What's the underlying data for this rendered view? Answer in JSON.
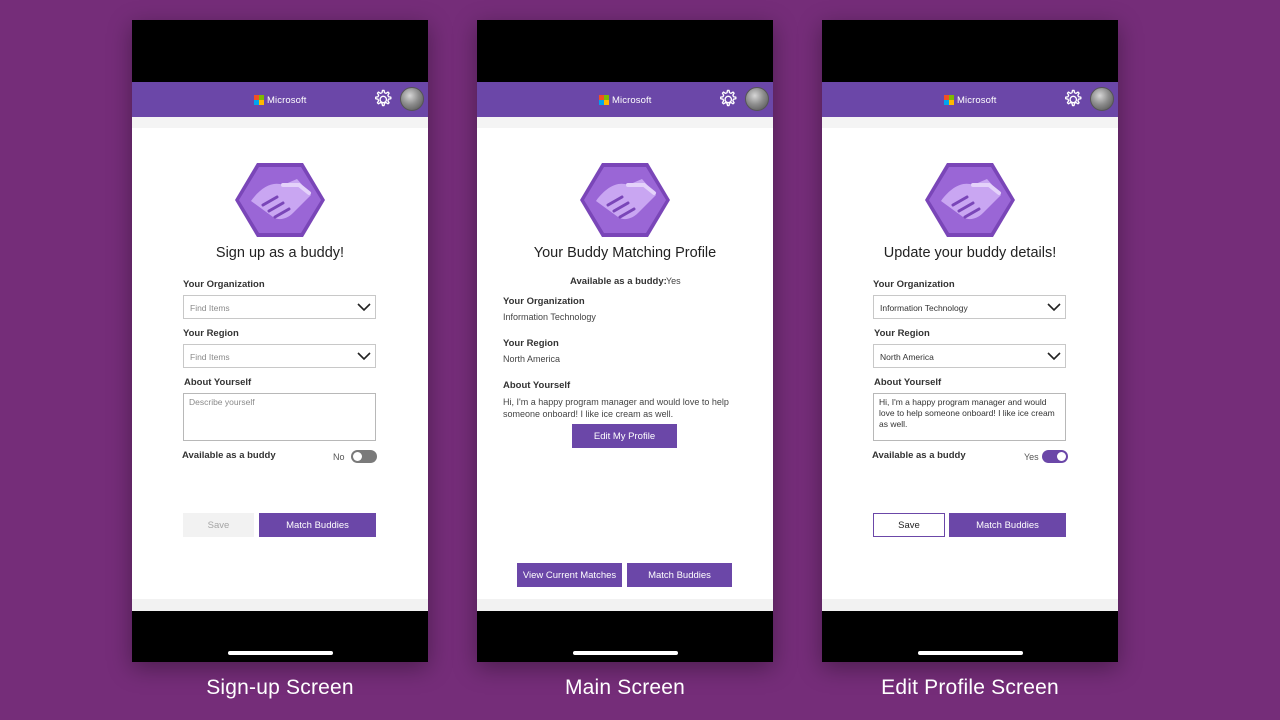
{
  "brand": {
    "name": "Microsoft",
    "colors": [
      "#f25022",
      "#7fba00",
      "#00a4ef",
      "#ffb900"
    ],
    "accent": "#6b47a8",
    "background": "#752d79"
  },
  "icons": {
    "logo": "handshake-hexagon-icon",
    "settings": "gear-icon",
    "profile": "avatar",
    "dropdown": "chevron-down-icon"
  },
  "screens": {
    "signup": {
      "title": "Sign up as a buddy!",
      "org_label": "Your Organization",
      "org_placeholder": "Find Items",
      "region_label": "Your Region",
      "region_placeholder": "Find Items",
      "about_label": "About Yourself",
      "about_placeholder": "Describe yourself",
      "available_label": "Available as a buddy",
      "available_value": "No",
      "available_on": false,
      "save_label": "Save",
      "match_label": "Match Buddies",
      "caption": "Sign-up Screen"
    },
    "main": {
      "title": "Your Buddy Matching Profile",
      "available_label": "Available as a buddy:",
      "available_value": "Yes",
      "org_label": "Your Organization",
      "org_value": "Information Technology",
      "region_label": "Your Region",
      "region_value": "North America",
      "about_label": "About Yourself",
      "about_value": "Hi, I'm a happy program manager and would love to help someone onboard! I like ice cream as well.",
      "edit_label": "Edit My Profile",
      "view_matches_label": "View Current Matches",
      "match_label": "Match Buddies",
      "caption": "Main Screen"
    },
    "edit": {
      "title": "Update your buddy details!",
      "org_label": "Your Organization",
      "org_value": "Information Technology",
      "region_label": "Your Region",
      "region_value": "North America",
      "about_label": "About Yourself",
      "about_value": "Hi, I'm a happy program manager and would love to help someone onboard! I like ice cream as well.",
      "available_label": "Available as a buddy",
      "available_value": "Yes",
      "available_on": true,
      "save_label": "Save",
      "match_label": "Match Buddies",
      "caption": "Edit Profile Screen"
    }
  }
}
